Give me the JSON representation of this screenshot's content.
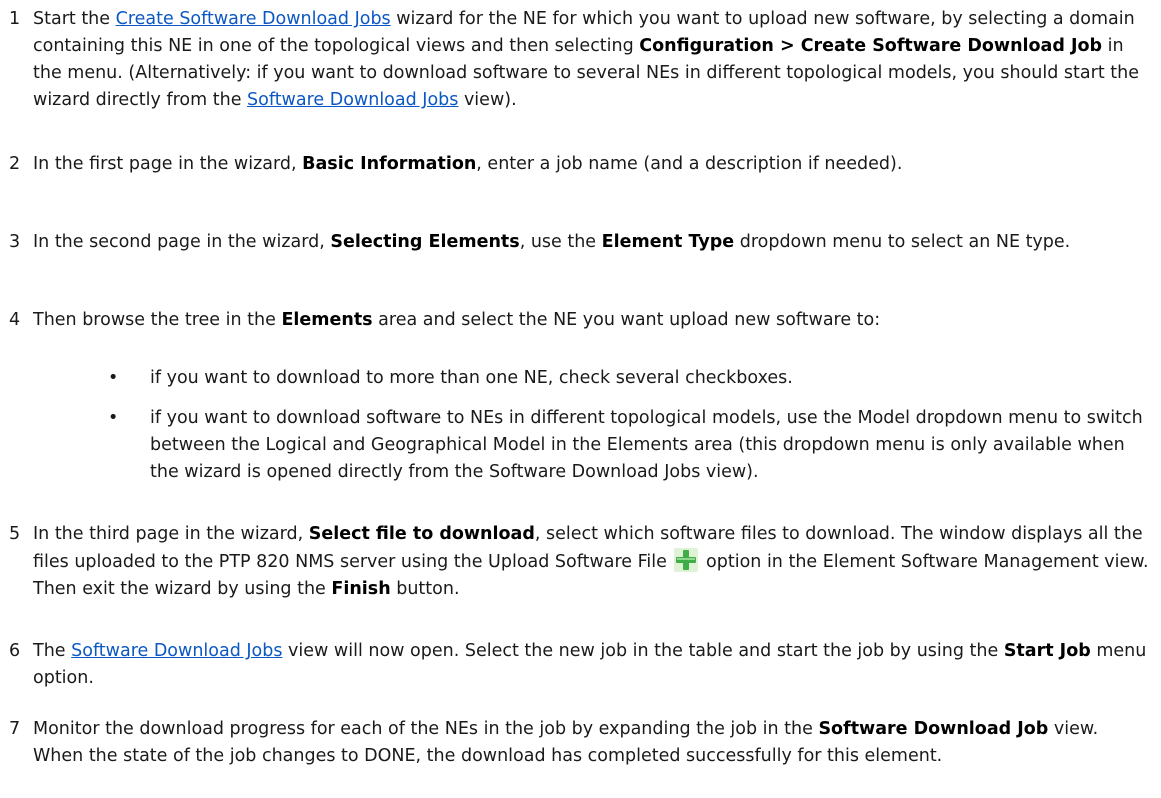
{
  "steps": [
    {
      "number": "1",
      "t1": "Start the ",
      "link1": "Create Software Download Jobs",
      "t2": " wizard for the NE for which you want to upload new software, by selecting a domain containing this NE in one of the topological views and then selecting ",
      "b1": "Configuration > Create Software Download Job",
      "t3": " in the menu. (Alternatively: if you want to download software to several NEs in different topological models, you should start the wizard directly from the ",
      "link2": "Software Download Jobs",
      "t4": " view)."
    },
    {
      "number": "2",
      "t1": "In the first page in the wizard, ",
      "b1": "Basic Information",
      "t2": ", enter a job name (and a description if needed)."
    },
    {
      "number": "3",
      "t1": "In the second page in the wizard, ",
      "b1": "Selecting Elements",
      "t2": ", use the ",
      "b2": "Element Type",
      "t3": " dropdown menu to select an NE type."
    },
    {
      "number": "4",
      "t1": "Then browse the tree in the ",
      "b1": "Elements",
      "t2": " area and select the NE you want upload new software to:",
      "bullets": [
        "if you want to download to more than one NE, check several checkboxes.",
        "if you want to download software to NEs in different topological models, use the Model dropdown menu to switch between the Logical and Geographical Model in the Elements area (this dropdown menu is only available when the wizard is opened directly from the Software Download Jobs view)."
      ]
    },
    {
      "number": "5",
      "t1": "In the third page in the wizard, ",
      "b1": "Select file to download",
      "t2": ", select which software files to download. The window displays all the files uploaded to the PTP 820 NMS server using the Upload Software File ",
      "icon": "green-plus-icon",
      "t3": " option in the Element Software Management view. Then exit the wizard by using the ",
      "b2": "Finish",
      "t4": " button."
    },
    {
      "number": "6",
      "t1": "The ",
      "link1": "Software Download Jobs",
      "t2": " view will now open. Select the new job in the table and start the job by using the ",
      "b1": "Start Job",
      "t3": " menu option."
    },
    {
      "number": "7",
      "t1": "Monitor the download progress for each of the NEs in the job by expanding the job in the ",
      "b1": "Software Download Job",
      "t2": " view. When the state of the job changes to DONE, the download has completed successfully for this element."
    }
  ],
  "bullet_symbol": "•",
  "colors": {
    "link": "#0b57c4",
    "text": "#1a1a1a",
    "icon_green": "#3fae49"
  }
}
